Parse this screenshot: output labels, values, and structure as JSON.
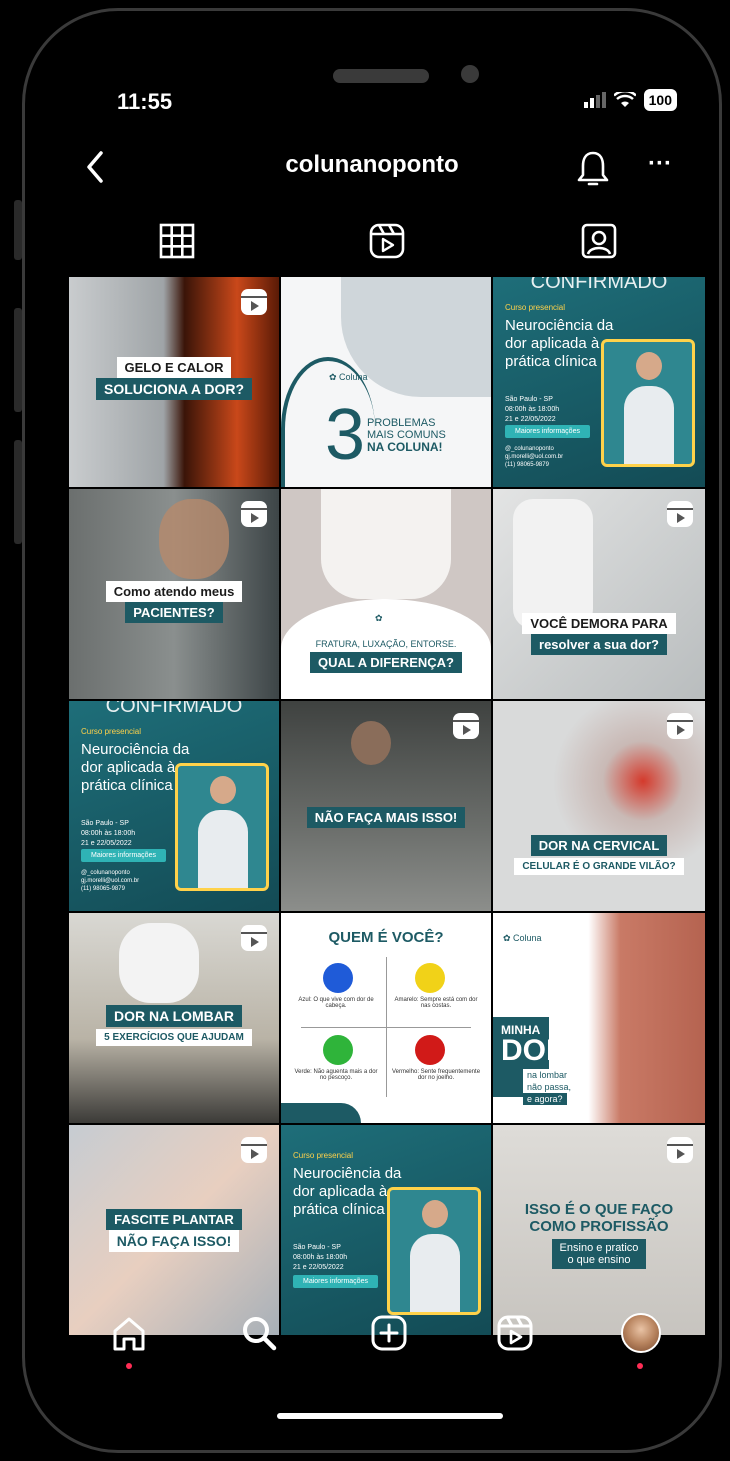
{
  "status": {
    "time": "11:55",
    "battery": "100"
  },
  "header": {
    "username": "colunanoponto"
  },
  "icons": {
    "back": "chevron-left-icon",
    "bell": "bell-icon",
    "more": "more-icon",
    "grid": "grid-icon",
    "reels": "reels-icon",
    "tagged": "tagged-icon",
    "home": "home-icon",
    "search": "search-icon",
    "create": "create-icon",
    "profile": "avatar"
  },
  "posts": {
    "p1": {
      "line1": "GELO E CALOR",
      "line2": "SOLUCIONA A DOR?"
    },
    "p2": {
      "num": "3",
      "line1": "PROBLEMAS",
      "line2": "MAIS COMUNS",
      "line3": "NA COLUNA!"
    },
    "course": {
      "top": "CONFIRMADO",
      "small": "Curso presencial",
      "title": "Neurociência da dor aplicada à prática clínica",
      "city": "São Paulo - SP",
      "hours": "08:00h às 18:00h",
      "dates": "21 e 22/05/2022",
      "button": "Maiores informações",
      "contact1": "@_colunanoponto",
      "contact2": "gj.morelli@uol.com.br",
      "contact3": "(11) 98065-9879"
    },
    "p4": {
      "line1": "Como atendo meus",
      "line2": "PACIENTES?"
    },
    "p5": {
      "line1": "FRATURA, LUXAÇÃO, ENTORSE.",
      "line2": "QUAL A DIFERENÇA?"
    },
    "p6": {
      "line1": "VOCÊ DEMORA PARA",
      "line2": "resolver a sua dor?"
    },
    "p8": {
      "line1": "NÃO FAÇA MAIS ISSO!"
    },
    "p9": {
      "line1": "DOR NA CERVICAL",
      "line2": "CELULAR É O GRANDE VILÃO?"
    },
    "p10": {
      "line1": "DOR NA LOMBAR",
      "line2": "5 EXERCÍCIOS QUE AJUDAM"
    },
    "p11": {
      "title": "QUEM É VOCÊ?",
      "azul": "Azul: O que vive com dor de cabeça.",
      "amarelo": "Amarelo: Sempre está com dor nas costas.",
      "verde": "Verde: Não aguenta mais a dor no pescoço.",
      "vermelho": "Vermelho: Sente frequentemente dor no joelho."
    },
    "p12": {
      "line1": "MINHA",
      "line2": "DOR",
      "line3": "na lombar",
      "line4": "não passa,",
      "line5": "e agora?"
    },
    "p13": {
      "line1": "FASCITE PLANTAR",
      "line2": "NÃO FAÇA ISSO!"
    },
    "p15": {
      "line1": "ISSO É O QUE FAÇO",
      "line2": "COMO PROFISSÃO",
      "line3": "Ensino e pratico",
      "line4": "o que ensino"
    }
  }
}
